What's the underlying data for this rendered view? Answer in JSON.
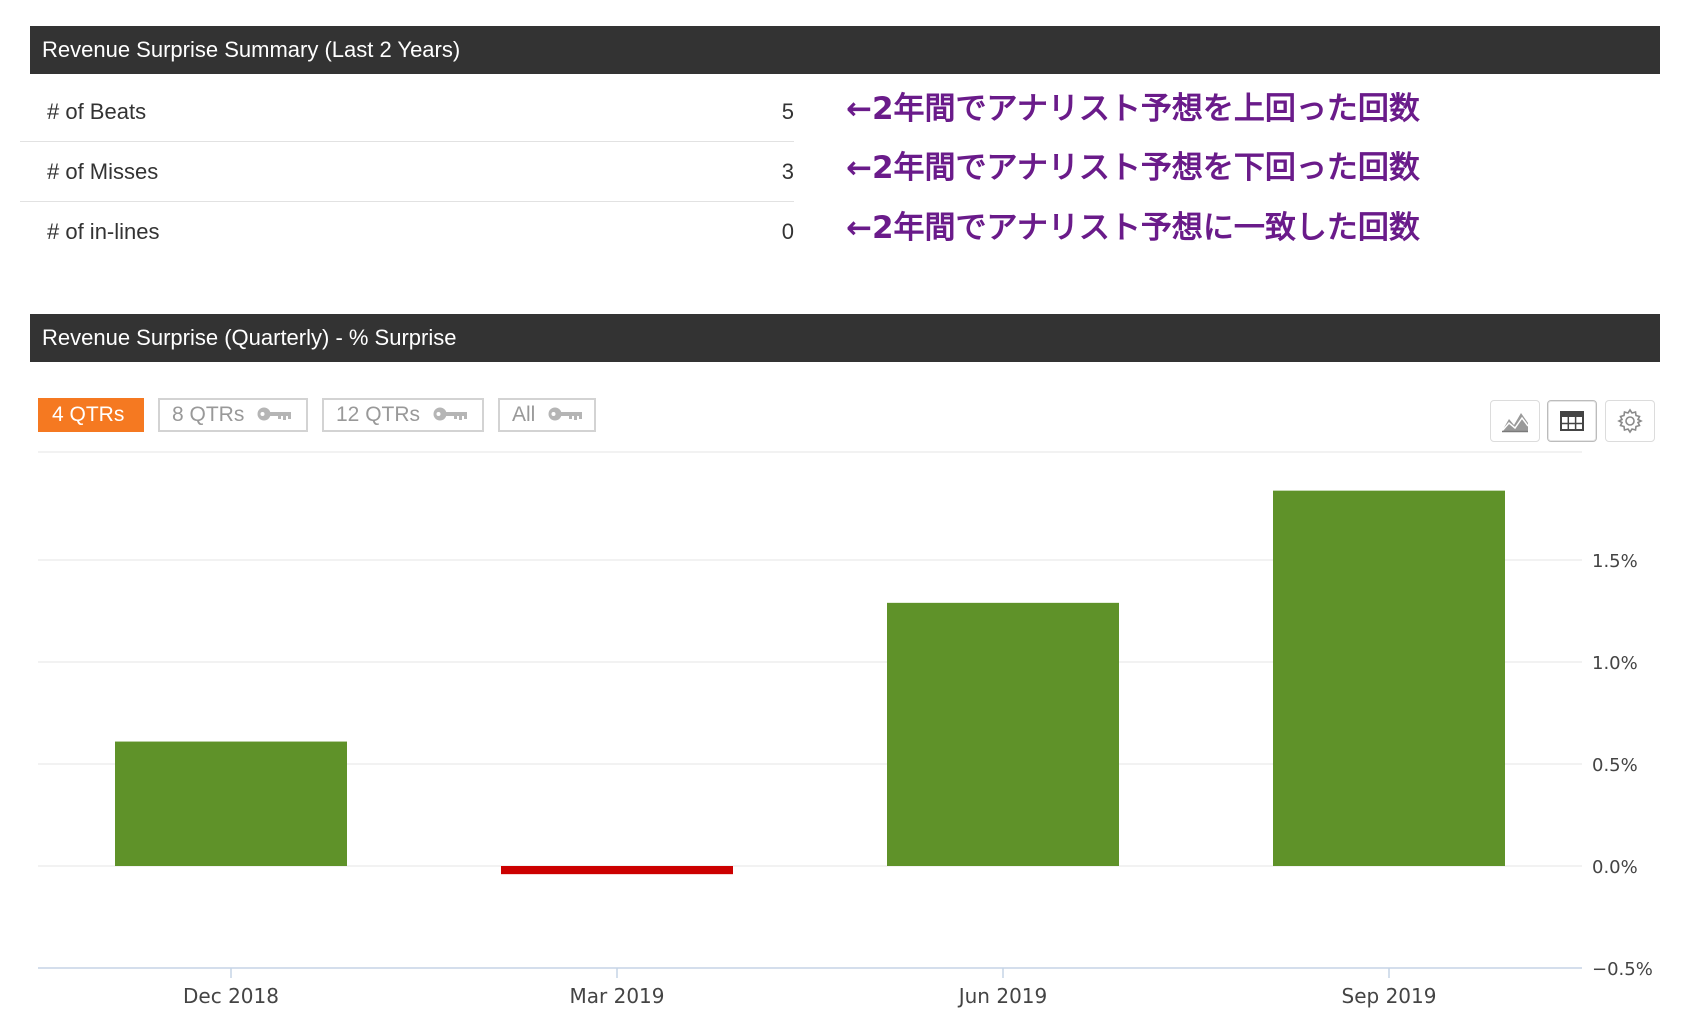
{
  "summary": {
    "title": "Revenue Surprise Summary (Last 2 Years)",
    "rows": [
      {
        "label": "# of Beats",
        "value": "5"
      },
      {
        "label": "# of Misses",
        "value": "3"
      },
      {
        "label": "# of in-lines",
        "value": "0"
      }
    ],
    "annotations": [
      "←2年間でアナリスト予想を上回った回数",
      "←2年間でアナリスト予想を下回った回数",
      "←2年間でアナリスト予想に一致した回数"
    ],
    "annotation_color": "#6a1b8a"
  },
  "chart_section": {
    "title": "Revenue Surprise (Quarterly) - % Surprise",
    "periods": [
      {
        "label": "4 QTRs",
        "active": true,
        "locked": false
      },
      {
        "label": "8 QTRs",
        "active": false,
        "locked": true
      },
      {
        "label": "12 QTRs",
        "active": false,
        "locked": true
      },
      {
        "label": "All",
        "active": false,
        "locked": true
      }
    ],
    "tools": [
      {
        "name": "area-chart-icon",
        "active": false
      },
      {
        "name": "table-icon",
        "active": true
      },
      {
        "name": "gear-icon",
        "active": false
      }
    ],
    "active_color": "#f57921"
  },
  "chart_data": {
    "type": "bar",
    "categories": [
      "Dec 2018",
      "Mar 2019",
      "Jun 2019",
      "Sep 2019"
    ],
    "values": [
      0.61,
      -0.04,
      1.29,
      1.84
    ],
    "ylim": [
      -0.5,
      1.9
    ],
    "yticks": [
      -0.5,
      0.0,
      0.5,
      1.0,
      1.5
    ],
    "ytick_labels": [
      "−0.5%",
      "0.0%",
      "0.5%",
      "1.0%",
      "1.5%"
    ],
    "title": "",
    "xlabel": "",
    "ylabel": "",
    "grid": true,
    "colors": {
      "positive": "#5f9229",
      "negative": "#cc0000"
    },
    "axis_side": "right"
  }
}
